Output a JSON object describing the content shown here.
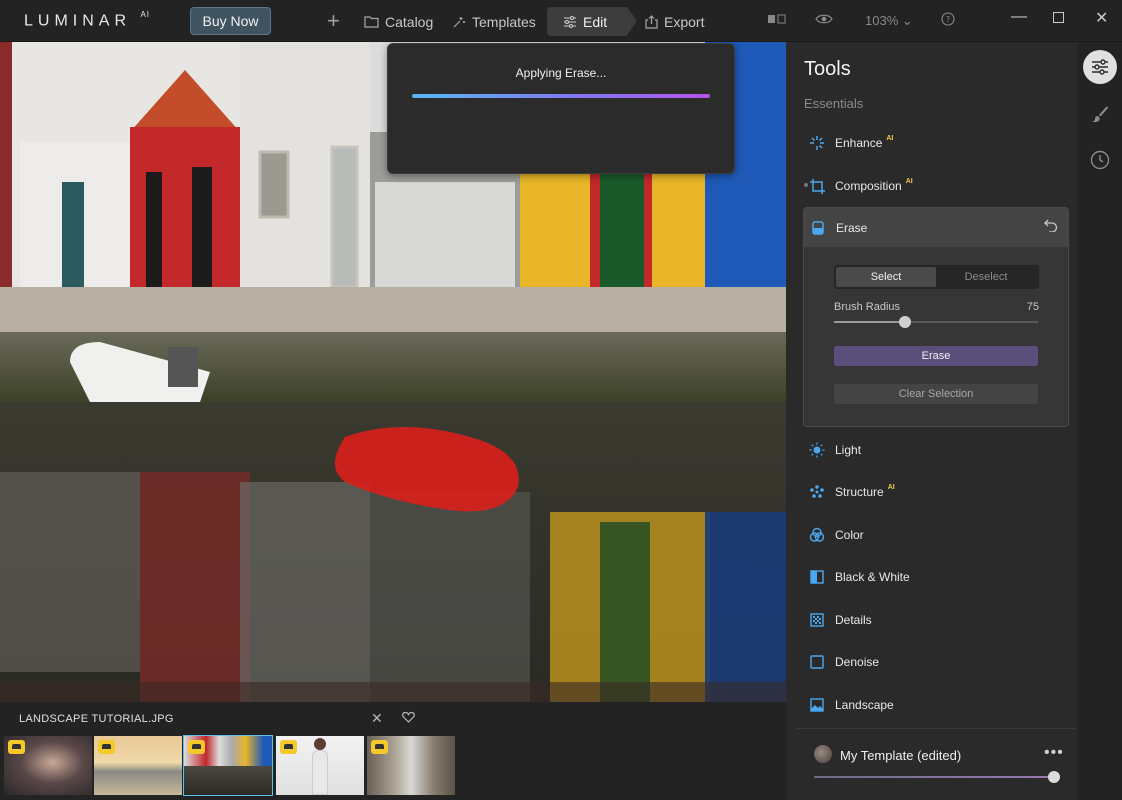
{
  "app": {
    "logo": "LUMINAR",
    "logo_sup": "AI"
  },
  "topbar": {
    "buy_label": "Buy Now",
    "nav": {
      "catalog": "Catalog",
      "templates": "Templates",
      "edit": "Edit",
      "export": "Export"
    },
    "zoom": "103%"
  },
  "canvas": {
    "progress_label": "Applying Erase...",
    "progress_value": 1.0
  },
  "filmstrip": {
    "file_name": "LANDSCAPE TUTORIAL.JPG"
  },
  "panel": {
    "title": "Tools",
    "section": "Essentials",
    "ai_tag": "AI",
    "tools": {
      "enhance": "Enhance",
      "composition": "Composition",
      "erase": "Erase",
      "light": "Light",
      "structure": "Structure",
      "color": "Color",
      "bw": "Black & White",
      "details": "Details",
      "denoise": "Denoise",
      "landscape": "Landscape"
    },
    "erase": {
      "select": "Select",
      "deselect": "Deselect",
      "brush_label": "Brush Radius",
      "brush_value": "75",
      "brush_fraction": 0.35,
      "erase_btn": "Erase",
      "clear_btn": "Clear Selection"
    },
    "template": {
      "name": "My Template (edited)",
      "amount_fraction": 1.0
    }
  },
  "colors": {
    "accent": "#4aa8f0",
    "ai_badge": "#f2c94c",
    "erase_button": "#5a4f7a",
    "selection_mask": "#d8201c"
  }
}
